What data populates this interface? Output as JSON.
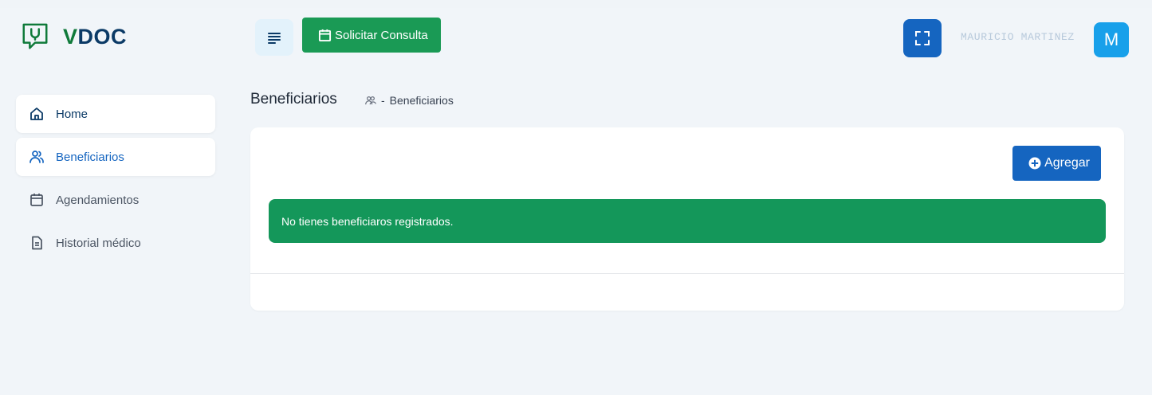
{
  "brand": {
    "logo_v": "V",
    "logo_rest": "DOC"
  },
  "sidebar": {
    "items": [
      {
        "label": "Home",
        "icon": "home-icon"
      },
      {
        "label": "Beneficiarios",
        "icon": "users-icon"
      },
      {
        "label": "Agendamientos",
        "icon": "calendar-icon"
      },
      {
        "label": "Historial médico",
        "icon": "document-icon"
      }
    ]
  },
  "header": {
    "consult_label": "Solicitar Consulta",
    "user_name": "MAURICIO MARTINEZ",
    "avatar_letter": "M"
  },
  "page": {
    "title": "Beneficiarios",
    "breadcrumb_sep": "-",
    "breadcrumb_label": "Beneficiarios"
  },
  "card": {
    "add_label": "Agregar",
    "empty_message": "No tienes beneficiaros registrados."
  },
  "colors": {
    "primary": "#1565c0",
    "success": "#1a9a55",
    "alert": "#14975a",
    "avatar": "#18a0ea",
    "background": "#f1f5f9"
  }
}
